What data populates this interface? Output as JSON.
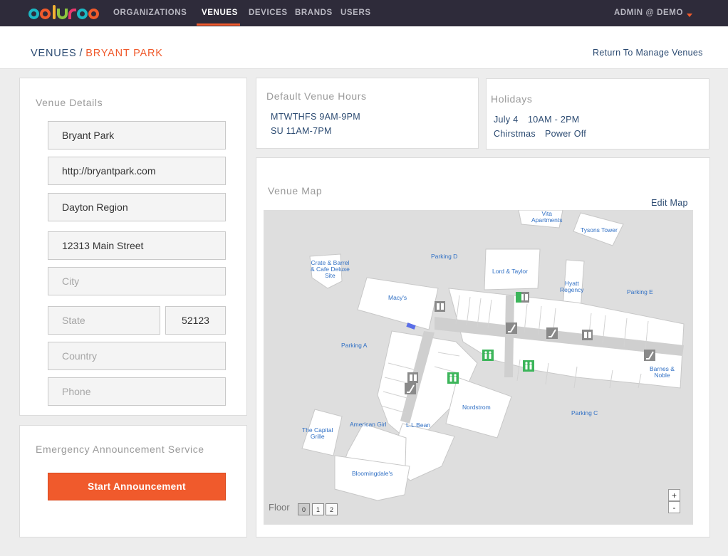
{
  "brand": {
    "logo_text": "ooluroo",
    "colors": [
      "#1cb8c4",
      "#f05a2c",
      "#f2b233",
      "#8dc63f",
      "#e5386d",
      "#1cb8c4",
      "#f05a2c"
    ]
  },
  "nav": {
    "items": [
      "ORGANIZATIONS",
      "VENUES",
      "DEVICES",
      "BRANDS",
      "USERS"
    ],
    "active": "VENUES",
    "user_menu": "ADMIN @ DEMO"
  },
  "breadcrumb": {
    "section": "VENUES",
    "separator": "/",
    "current": "BRYANT PARK"
  },
  "return_link": "Return To Manage Venues",
  "venue_details": {
    "title": "Venue Details",
    "name": "Bryant Park",
    "url": "http://bryantpark.com",
    "region": "Dayton Region",
    "address": "12313 Main Street",
    "city_placeholder": "City",
    "state_placeholder": "State",
    "zip": "52123",
    "country_placeholder": "Country",
    "phone_placeholder": "Phone"
  },
  "emergency": {
    "title": "Emergency Announcement Service",
    "button": "Start Announcement"
  },
  "hours": {
    "title": "Default Venue Hours",
    "line1": "MTWTHFS 9AM-9PM",
    "line2": "SU 11AM-7PM"
  },
  "holidays": {
    "title": "Holidays",
    "entries": [
      {
        "day": "July 4",
        "hours": "10AM - 2PM"
      },
      {
        "day": "Chirstmas",
        "hours": "Power Off"
      }
    ]
  },
  "venue_map": {
    "title": "Venue Map",
    "edit": "Edit Map",
    "floor_label": "Floor",
    "floors": [
      "0",
      "1",
      "2"
    ],
    "selected_floor": "0",
    "zoom_in": "+",
    "zoom_out": "-",
    "labels": {
      "vita": "Vita\nApartments",
      "tysons": "Tysons Tower",
      "parking_d": "Parking D",
      "crate": "Crate & Barrel\n& Cafe Deluxe\nSite",
      "lord_taylor": "Lord & Taylor",
      "hyatt": "Hyatt\nRegency",
      "parking_e": "Parking E",
      "macys": "Macy's",
      "parking_a": "Parking A",
      "barnes": "Barnes &\nNoble",
      "nordstrom": "Nordstrom",
      "parking_c": "Parking C",
      "capital_grille": "The Capital\nGrille",
      "american_girl": "American Girl",
      "ll_bean": "L.L.Bean",
      "bloomingdales": "Bloomingdale's"
    },
    "label_color": "#2f6fc4",
    "restroom_color": "#3cb55a"
  }
}
